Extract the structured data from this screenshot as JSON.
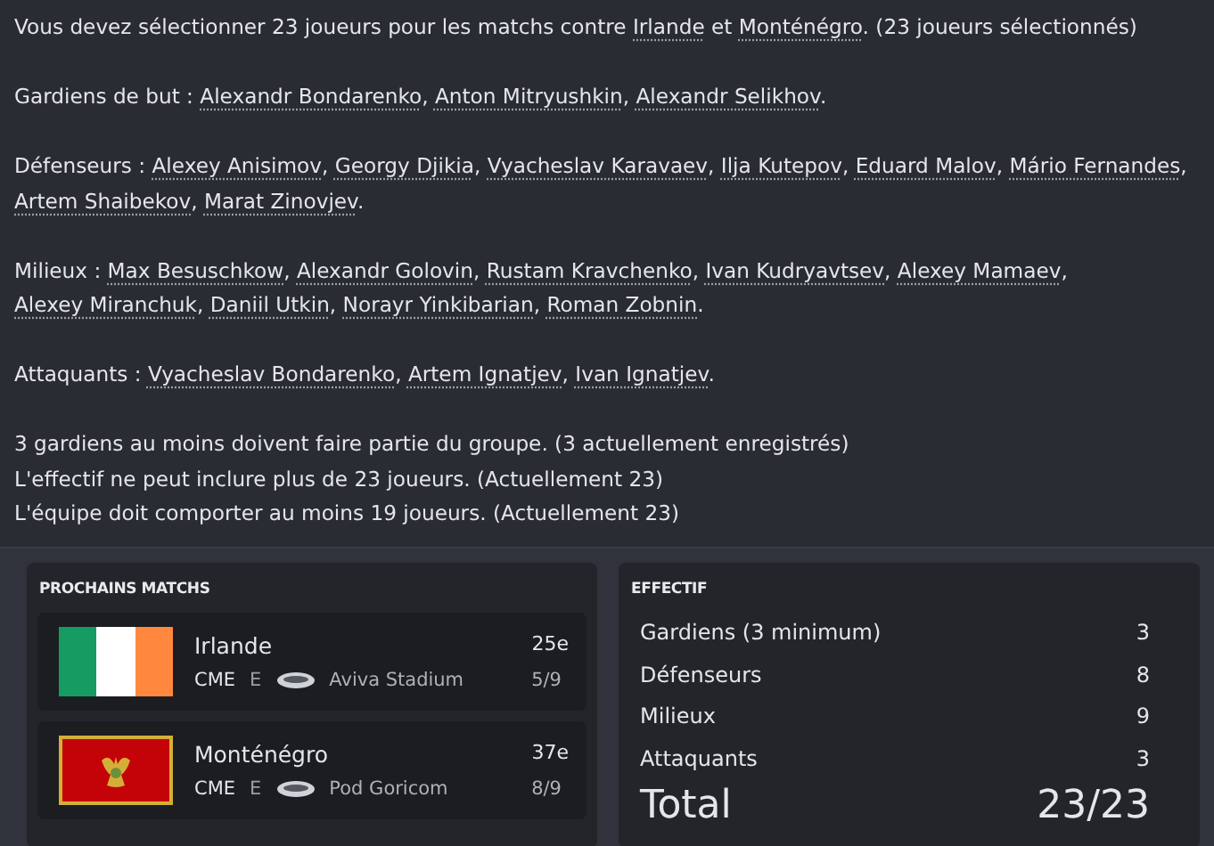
{
  "intro": [
    {
      "text": "Vous devez sélectionner 23 joueurs pour les matchs contre ",
      "link": false
    },
    {
      "text": "Irlande",
      "link": true
    },
    {
      "text": " et ",
      "link": false
    },
    {
      "text": "Monténégro",
      "link": true
    },
    {
      "text": ". (23 joueurs sélectionnés)",
      "link": false
    }
  ],
  "groups": [
    {
      "label": "Gardiens de but : ",
      "players": [
        "Alexandr Bondarenko",
        "Anton Mitryushkin",
        "Alexandr Selikhov"
      ],
      "separator": ", ",
      "end": "."
    },
    {
      "label": "Défenseurs : ",
      "players": [
        "Alexey Anisimov",
        "Georgy Djikia",
        "Vyacheslav Karavaev",
        "Ilja Kutepov",
        "Eduard Malov",
        "Mário Fernandes",
        "Artem Shaibekov",
        "Marat Zinovjev"
      ],
      "separator": ", ",
      "end": "."
    },
    {
      "label": "Milieux : ",
      "players": [
        "Max Besuschkow",
        "Alexandr Golovin",
        "Rustam Kravchenko",
        "Ivan Kudryavtsev",
        "Alexey Mamaev",
        "Alexey Miranchuk",
        "Daniil Utkin",
        "Norayr Yinkibarian",
        "Roman Zobnin"
      ],
      "separator": ", ",
      "end": "."
    },
    {
      "label": "Attaquants : ",
      "players": [
        "Vyacheslav Bondarenko",
        "Artem Ignatjev",
        "Ivan Ignatjev"
      ],
      "separator": ", ",
      "end": "."
    }
  ],
  "rules": [
    "3 gardiens au moins doivent faire partie du groupe. (3 actuellement enregistrés)",
    "L'effectif ne peut inclure plus de 23 joueurs. (Actuellement 23)",
    "L'équipe doit comporter au moins 19 joueurs. (Actuellement 23)"
  ],
  "matches": {
    "title": "PROCHAINS MATCHS",
    "items": [
      {
        "team": "Irlande",
        "kind": "ireland",
        "rank": "25e",
        "competition": "CME",
        "venue_type": "E",
        "stadium": "Aviva Stadium",
        "round": "5/9"
      },
      {
        "team": "Monténégro",
        "kind": "montenegro",
        "rank": "37e",
        "competition": "CME",
        "venue_type": "E",
        "stadium": "Pod Goricom",
        "round": "8/9"
      }
    ]
  },
  "squad": {
    "title": "EFFECTIF",
    "rows": [
      {
        "label": "Gardiens (3 minimum)",
        "value": "3"
      },
      {
        "label": "Défenseurs",
        "value": "8"
      },
      {
        "label": "Milieux",
        "value": "9"
      },
      {
        "label": "Attaquants",
        "value": "3"
      }
    ],
    "total": {
      "label": "Total",
      "value": "23/23"
    }
  }
}
